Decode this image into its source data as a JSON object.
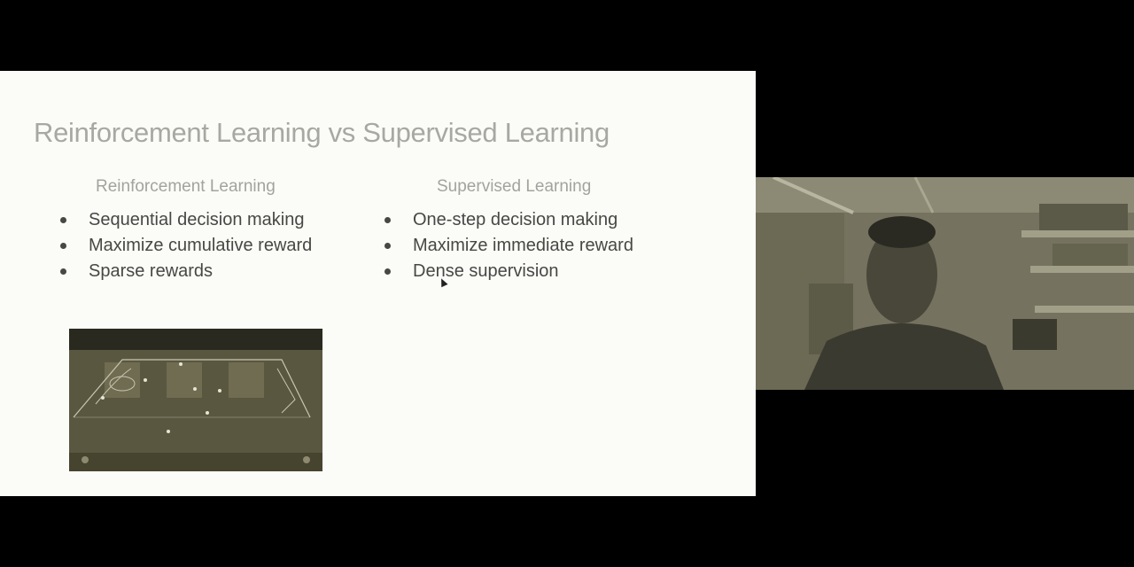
{
  "slide": {
    "title": "Reinforcement Learning vs Supervised Learning",
    "left_column": {
      "heading": "Reinforcement Learning",
      "bullets": [
        "Sequential decision making",
        "Maximize cumulative reward",
        "Sparse rewards"
      ]
    },
    "right_column": {
      "heading": "Supervised Learning",
      "bullets": [
        "One-step decision making",
        "Maximize immediate reward",
        "Dense supervision"
      ]
    },
    "image_icon": "soccer-game-screenshot"
  },
  "webcam": {
    "icon": "presenter-video"
  }
}
